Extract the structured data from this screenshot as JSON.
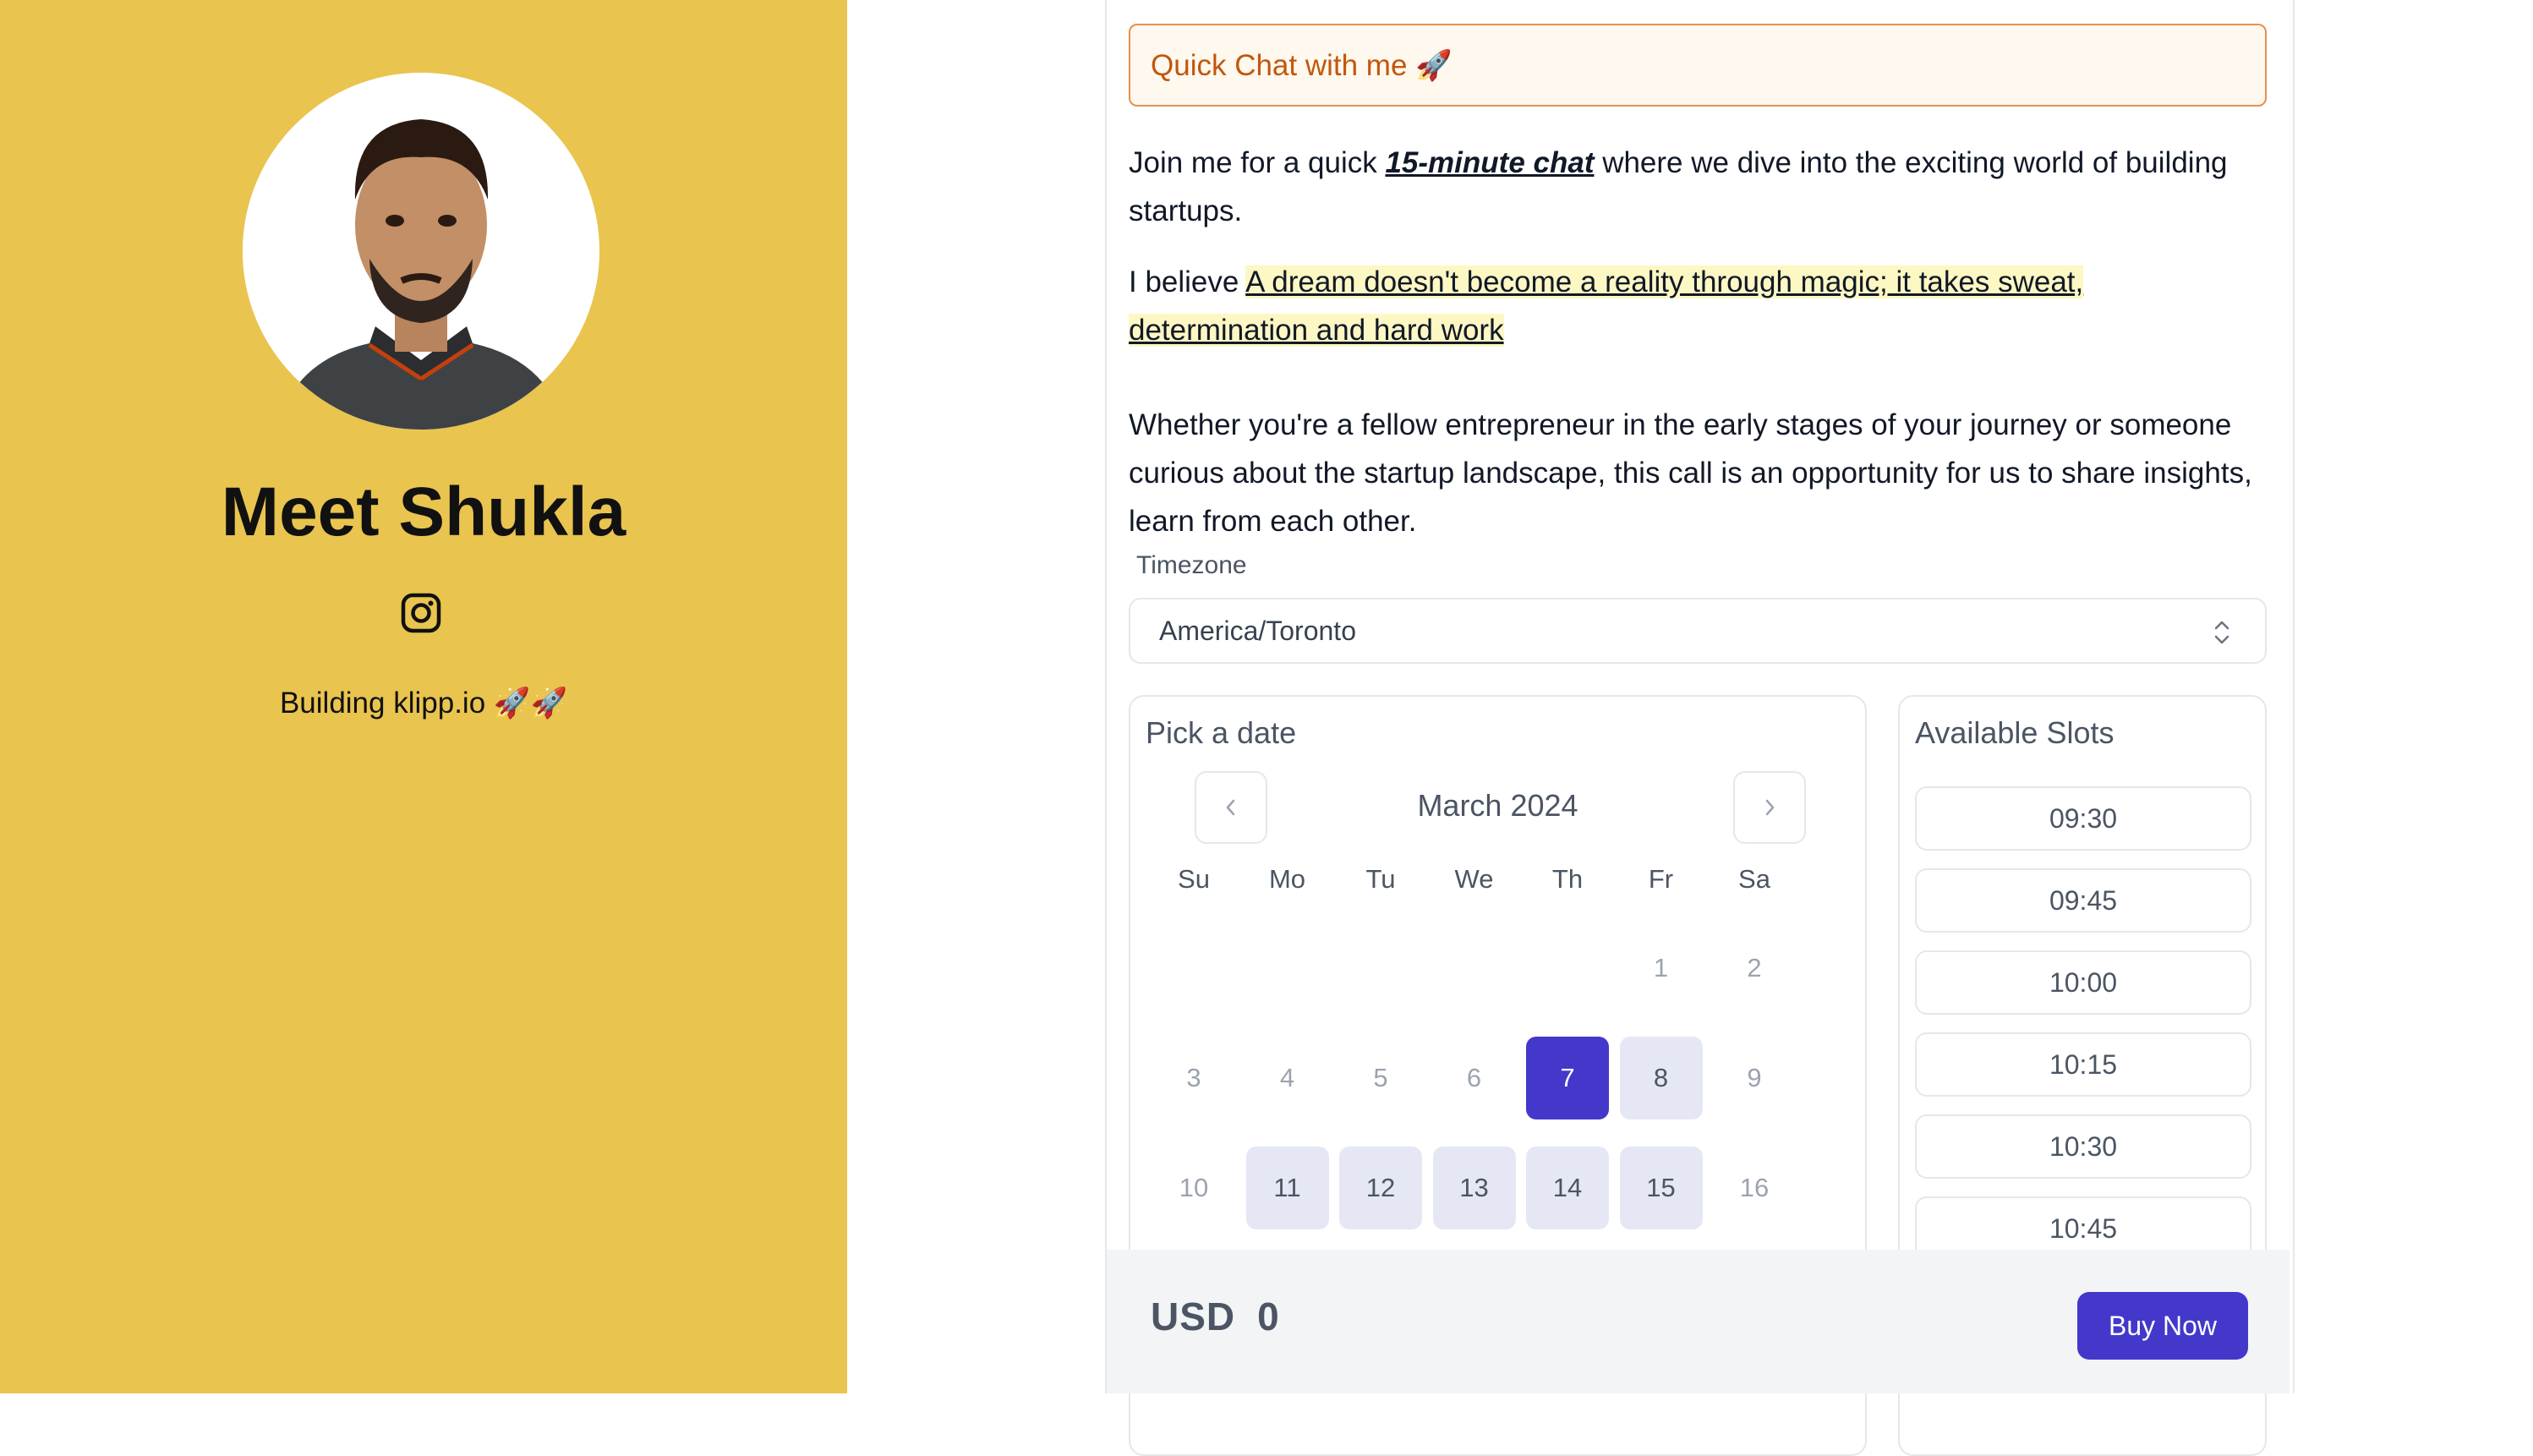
{
  "profile": {
    "name": "Meet Shukla",
    "bio": "Building klipp.io 🚀🚀",
    "social_icon": "instagram-icon",
    "background_color": "#E9C44F"
  },
  "event": {
    "title": "Quick Chat with me  🚀",
    "para1_before": "Join me for a quick ",
    "para1_emphasis": "15-minute chat",
    "para1_after": " where we dive into the exciting world of building startups.",
    "para2_before": "I believe ",
    "para2_highlight": "A dream doesn't become a reality through magic; it takes sweat, determination and hard work",
    "para3": "Whether you're a fellow entrepreneur in the early stages of your journey or someone curious about the startup landscape, this call is an opportunity for us to share insights, learn from each other."
  },
  "timezone": {
    "label": "Timezone",
    "value": "America/Toronto"
  },
  "calendar": {
    "title": "Pick a date",
    "month": "March 2024",
    "prev_icon": "chevron-left-icon",
    "next_icon": "chevron-right-icon",
    "weekdays": [
      "Su",
      "Mo",
      "Tu",
      "We",
      "Th",
      "Fr",
      "Sa"
    ],
    "days": [
      {
        "label": "1",
        "state": "disabled"
      },
      {
        "label": "2",
        "state": "disabled"
      },
      {
        "label": "3",
        "state": "disabled"
      },
      {
        "label": "4",
        "state": "disabled"
      },
      {
        "label": "5",
        "state": "disabled"
      },
      {
        "label": "6",
        "state": "disabled"
      },
      {
        "label": "7",
        "state": "selected"
      },
      {
        "label": "8",
        "state": "available"
      },
      {
        "label": "9",
        "state": "disabled"
      },
      {
        "label": "10",
        "state": "disabled"
      },
      {
        "label": "11",
        "state": "available"
      },
      {
        "label": "12",
        "state": "available"
      },
      {
        "label": "13",
        "state": "available"
      },
      {
        "label": "14",
        "state": "available"
      },
      {
        "label": "15",
        "state": "available"
      },
      {
        "label": "16",
        "state": "disabled"
      }
    ]
  },
  "slots": {
    "title": "Available Slots",
    "times": [
      "09:30",
      "09:45",
      "10:00",
      "10:15",
      "10:30",
      "10:45"
    ]
  },
  "footer": {
    "currency": "USD",
    "amount": "0",
    "buy_label": "Buy Now",
    "accent_color": "#4338CA"
  }
}
